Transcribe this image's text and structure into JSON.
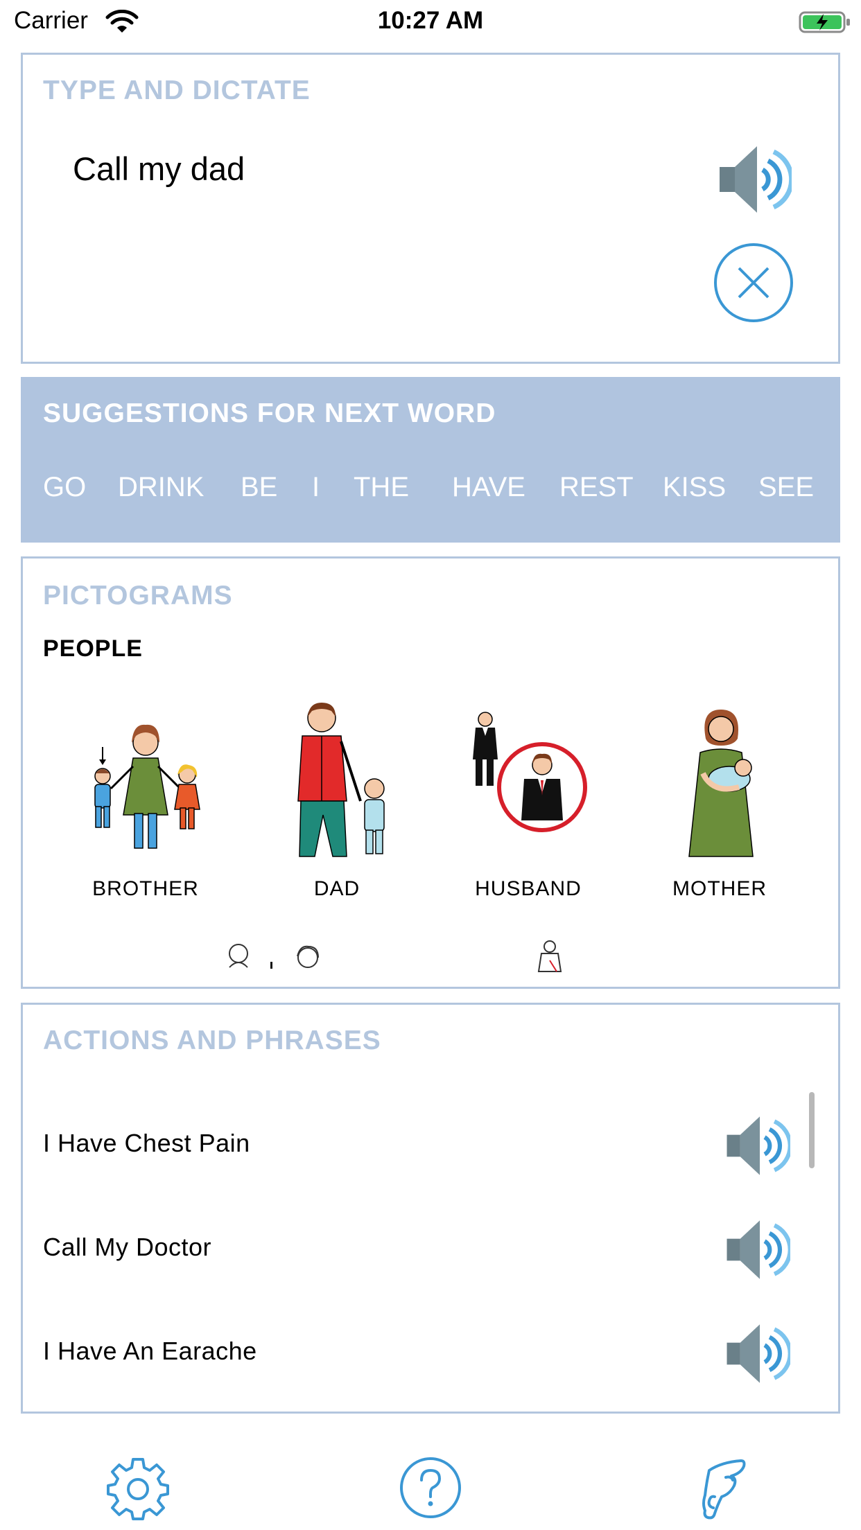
{
  "status_bar": {
    "carrier": "Carrier",
    "time": "10:27 AM",
    "battery_state": "charging"
  },
  "type_card": {
    "title": "TYPE AND DICTATE",
    "text": "Call my dad",
    "speak_icon": "speaker-icon",
    "clear_icon": "close-circle-icon"
  },
  "suggestions": {
    "title": "SUGGESTIONS FOR NEXT WORD",
    "words": [
      "GO",
      "DRINK",
      "BE",
      "I",
      "THE",
      "HAVE",
      "REST",
      "KISS",
      "SEE"
    ]
  },
  "pictograms": {
    "title": "PICTOGRAMS",
    "category": "PEOPLE",
    "items": [
      {
        "label": "BROTHER",
        "icon": "brother-pictogram-icon"
      },
      {
        "label": "DAD",
        "icon": "dad-pictogram-icon"
      },
      {
        "label": "HUSBAND",
        "icon": "husband-pictogram-icon"
      },
      {
        "label": "MOTHER",
        "icon": "mother-pictogram-icon"
      }
    ]
  },
  "actions": {
    "title": "ACTIONS AND PHRASES",
    "phrases": [
      "I Have Chest Pain",
      "Call My Doctor",
      "I Have An Earache"
    ]
  },
  "toolbar": {
    "settings_icon": "gear-icon",
    "help_icon": "help-icon",
    "hand_icon": "hand-icon"
  },
  "colors": {
    "accent": "#3a97d4",
    "card_border": "#b3c6de",
    "suggestion_bg": "#b0c4df"
  }
}
